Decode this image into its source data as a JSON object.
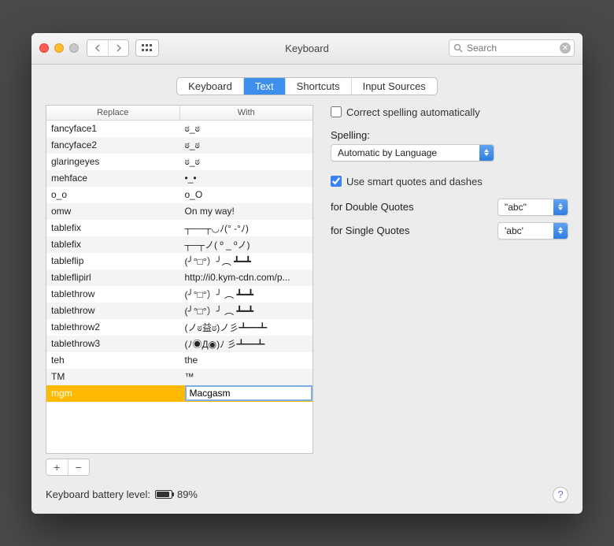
{
  "window": {
    "title": "Keyboard"
  },
  "search": {
    "placeholder": "Search"
  },
  "tabs": [
    "Keyboard",
    "Text",
    "Shortcuts",
    "Input Sources"
  ],
  "active_tab": "Text",
  "table": {
    "headers": {
      "replace": "Replace",
      "with": "With"
    },
    "rows": [
      {
        "replace": "fancyface1",
        "with": "ಠ_ಠ"
      },
      {
        "replace": "fancyface2",
        "with": "ಠ_ಠ"
      },
      {
        "replace": "glaringeyes",
        "with": "ಠ_ಠ"
      },
      {
        "replace": "mehface",
        "with": "•_•"
      },
      {
        "replace": "o_o",
        "with": "o_O"
      },
      {
        "replace": "omw",
        "with": "On my way!"
      },
      {
        "replace": "tablefix",
        "with": "┬──┬◡ﾉ(° -°ﾉ)"
      },
      {
        "replace": "tablefix",
        "with": "┬─┬ノ( º _ ºノ)"
      },
      {
        "replace": "tableflip",
        "with": "(╯°□°）╯︵ ┻━┻"
      },
      {
        "replace": "tableflipirl",
        "with": "http://i0.kym-cdn.com/p..."
      },
      {
        "replace": "tablethrow",
        "with": "(╯°□°）╯ ︵ ┻━┻"
      },
      {
        "replace": "tablethrow",
        "with": "(╯°□°）╯ ︵ ┻━┻"
      },
      {
        "replace": "tablethrow2",
        "with": "(ノಠ益ಠ)ノ彡┻━┻"
      },
      {
        "replace": "tablethrow3",
        "with": "(ﾉ◉Д◉)ﾉ 彡┻━┻"
      },
      {
        "replace": "teh",
        "with": "the"
      },
      {
        "replace": "TM",
        "with": "™"
      }
    ],
    "editing_row": {
      "replace": "mgm",
      "with": "Macgasm"
    }
  },
  "options": {
    "correct_spelling_label": "Correct spelling automatically",
    "correct_spelling_checked": false,
    "spelling_label": "Spelling:",
    "spelling_value": "Automatic by Language",
    "smart_quotes_label": "Use smart quotes and dashes",
    "smart_quotes_checked": true,
    "double_quotes_label": "for Double Quotes",
    "double_quotes_value": "\"abc\"",
    "single_quotes_label": "for Single Quotes",
    "single_quotes_value": "'abc'"
  },
  "footer": {
    "battery_label": "Keyboard battery level:",
    "battery_pct_text": "89%",
    "battery_pct": 89
  }
}
